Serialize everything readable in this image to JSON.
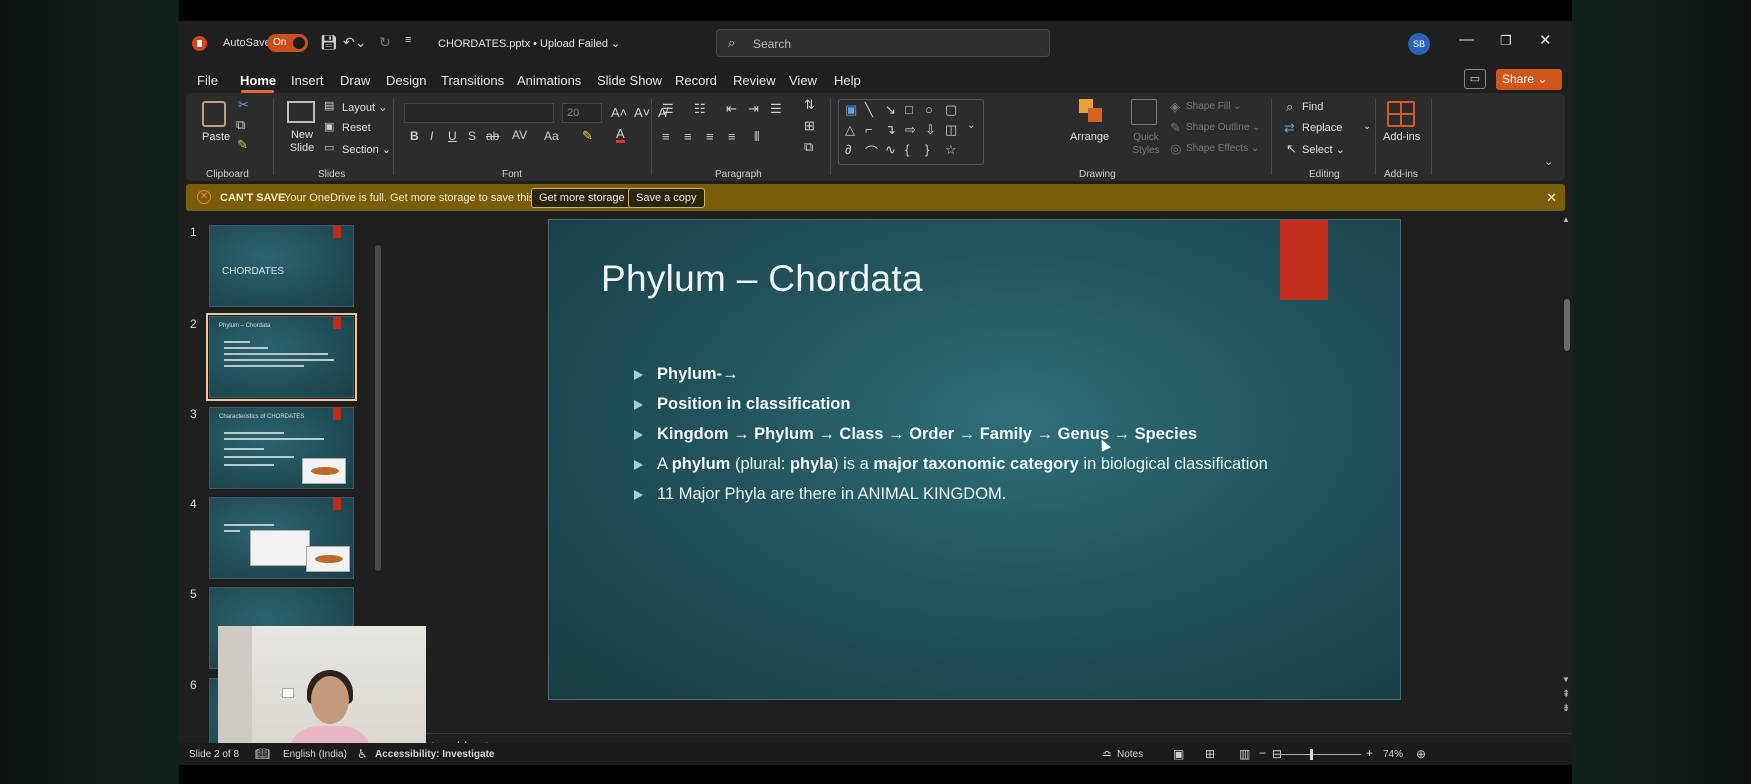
{
  "titlebar": {
    "autosave_label": "AutoSave",
    "autosave_state": "On",
    "doc_title": "CHORDATES.pptx • Upload Failed ⌄",
    "search_placeholder": "Search",
    "avatar_initials": "SB"
  },
  "menu": [
    "File",
    "Home",
    "Insert",
    "Draw",
    "Design",
    "Transitions",
    "Animations",
    "Slide Show",
    "Record",
    "Review",
    "View",
    "Help"
  ],
  "share_label": "Share ⌄",
  "ribbon": {
    "paste": "Paste",
    "new_slide": "New Slide",
    "layout": "Layout ⌄",
    "reset": "Reset",
    "section": "Section ⌄",
    "font_size": "20",
    "arrange": "Arrange",
    "quick_styles": "Quick Styles",
    "shape_fill": "Shape Fill ⌄",
    "shape_outline": "Shape Outline ⌄",
    "shape_effects": "Shape Effects ⌄",
    "find": "Find",
    "replace": "Replace",
    "select": "Select ⌄",
    "addins": "Add-ins",
    "groups": {
      "clipboard": "Clipboard",
      "slides": "Slides",
      "font": "Font",
      "paragraph": "Paragraph",
      "drawing": "Drawing",
      "editing": "Editing",
      "addins": "Add-ins"
    }
  },
  "warning": {
    "title": "CAN'T SAVE",
    "message": "Your OneDrive is full. Get more storage to save this file.",
    "btn_storage": "Get more storage",
    "btn_copy": "Save a copy"
  },
  "thumbnails": {
    "numbers": [
      "1",
      "2",
      "3",
      "4",
      "5",
      "6"
    ],
    "slide1_title": "CHORDATES",
    "slide2_title": "Phylum – Chordata",
    "slide3_title": "Characteristics of CHORDATES"
  },
  "slide": {
    "title": "Phylum – Chordata",
    "bullets": {
      "b1": "Phylum-→",
      "b2": "Position in classification",
      "b3": "Kingdom → Phylum → Class → Order → Family → Genus → Species",
      "b4_a": "A ",
      "b4_b": "phylum",
      "b4_c": " (plural: ",
      "b4_d": "phyla",
      "b4_e": ") is a ",
      "b4_f": "major taxonomic category",
      "b4_g": " in biological classification",
      "b5": "11 Major Phyla are there in ANIMAL KINGDOM."
    }
  },
  "notes_placeholder": "to add notes",
  "status": {
    "slide_count": "Slide 2 of 8",
    "language": "English (India)",
    "accessibility": "Accessibility: Investigate",
    "notes": "Notes",
    "zoom": "74%"
  }
}
